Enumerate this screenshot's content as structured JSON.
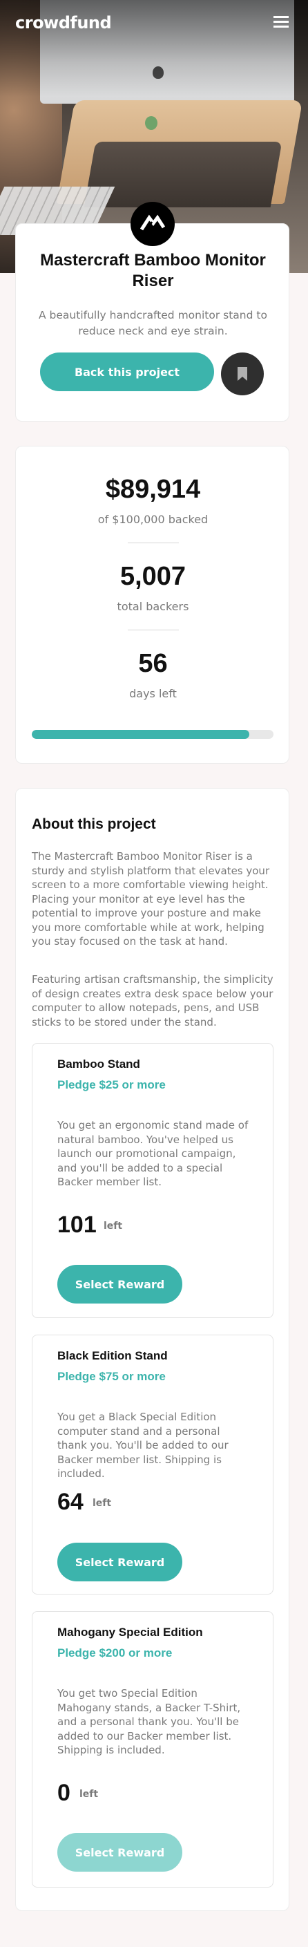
{
  "brand": "crowdfund",
  "colors": {
    "accent": "#3cb4ac",
    "accent_muted": "#8dd6d0",
    "dark": "#2f2f2f",
    "background": "#faf5f5"
  },
  "header": {
    "menu_icon": "hamburger-icon",
    "hero_image": "monitor on bamboo riser"
  },
  "intro": {
    "logo_icon": "mastercraft-logo-icon",
    "title": "Mastercraft Bamboo Monitor Riser",
    "subtitle": "A beautifully handcrafted monitor stand to reduce neck and eye strain.",
    "back_button": "Back this project",
    "bookmark_icon": "bookmark-icon"
  },
  "stats": {
    "backed_value": "$89,914",
    "backed_label": "of $100,000 backed",
    "backers_value": "5,007",
    "backers_label": "total backers",
    "days_value": "56",
    "days_label": "days left",
    "progress": 0.8991
  },
  "about": {
    "title": "About this project",
    "paragraph1": "The Mastercraft Bamboo Monitor Riser is a sturdy and stylish platform that elevates your screen to a more comfortable viewing height. Placing your monitor at eye level has the potential to improve your posture and make you more comfortable while at work, helping you stay focused on the task at hand.",
    "paragraph2": "Featuring artisan craftsmanship, the simplicity of design creates extra desk space below your computer to allow notepads, pens, and USB sticks to be stored under the stand.",
    "rewards": [
      {
        "name": "Bamboo Stand",
        "pledge": "Pledge $25 or more",
        "description": "You get an ergonomic stand made of natural bamboo. You've helped us launch our promotional campaign, and you'll be added to a special Backer member list.",
        "left_count": "101",
        "left_label": "left",
        "button": "Select Reward",
        "available": true
      },
      {
        "name": "Black Edition Stand",
        "pledge": "Pledge $75 or more",
        "description": "You get a Black Special Edition computer stand and a personal thank you. You'll be added to our Backer member list. Shipping is included.",
        "left_count": "64",
        "left_label": "left",
        "button": "Select Reward",
        "available": true
      },
      {
        "name": "Mahogany Special Edition",
        "pledge": "Pledge $200 or more",
        "description": "You get two Special Edition Mahogany stands, a Backer T-Shirt, and a personal thank you. You'll be added to our Backer member list. Shipping is included.",
        "left_count": "0",
        "left_label": "left",
        "button": "Select Reward",
        "available": false
      }
    ]
  }
}
